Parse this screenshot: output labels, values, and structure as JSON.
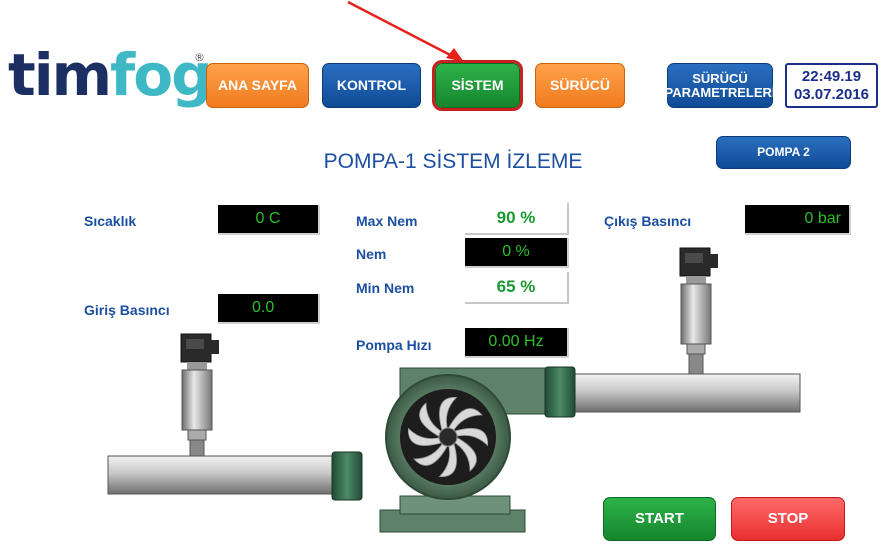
{
  "brand": {
    "part1": "tim",
    "part2": "fog",
    "reg_mark": "®"
  },
  "nav": {
    "home": "ANA SAYFA",
    "control": "KONTROL",
    "system": "SİSTEM",
    "driver": "SÜRÜCÜ",
    "driver_params_line1": "SÜRÜCÜ",
    "driver_params_line2": "PARAMETRELERİ"
  },
  "datetime": {
    "time": "22:49.19",
    "date": "03.07.2016"
  },
  "page": {
    "title": "POMPA-1 SİSTEM İZLEME",
    "pump2_button": "POMPA 2"
  },
  "readings": {
    "temperature_label": "Sıcaklık",
    "temperature_value": "0 C",
    "inlet_pressure_label": "Giriş Basıncı",
    "inlet_pressure_value": "0.0",
    "outlet_pressure_label": "Çıkış Basıncı",
    "outlet_pressure_value": "0 bar",
    "max_humidity_label": "Max Nem",
    "max_humidity_value": "90 %",
    "humidity_label": "Nem",
    "humidity_value": "0 %",
    "min_humidity_label": "Min Nem",
    "min_humidity_value": "65 %",
    "pump_speed_label": "Pompa Hızı",
    "pump_speed_value": "0.00 Hz"
  },
  "actions": {
    "start": "START",
    "stop": "STOP"
  },
  "colors": {
    "nav_orange": "#f07b1f",
    "nav_blue": "#104a96",
    "active_green": "#16862d",
    "active_outline": "#c92121",
    "label_blue": "#1c4fa0",
    "display_green": "#2dbf2d",
    "start_green": "#16862d",
    "stop_red": "#e92f2f",
    "annotation_arrow": "#e8201a"
  },
  "icons": {
    "arrow": "annotation-arrow-icon",
    "pump": "centrifugal-pump-icon",
    "sensor": "pressure-transmitter-icon"
  }
}
